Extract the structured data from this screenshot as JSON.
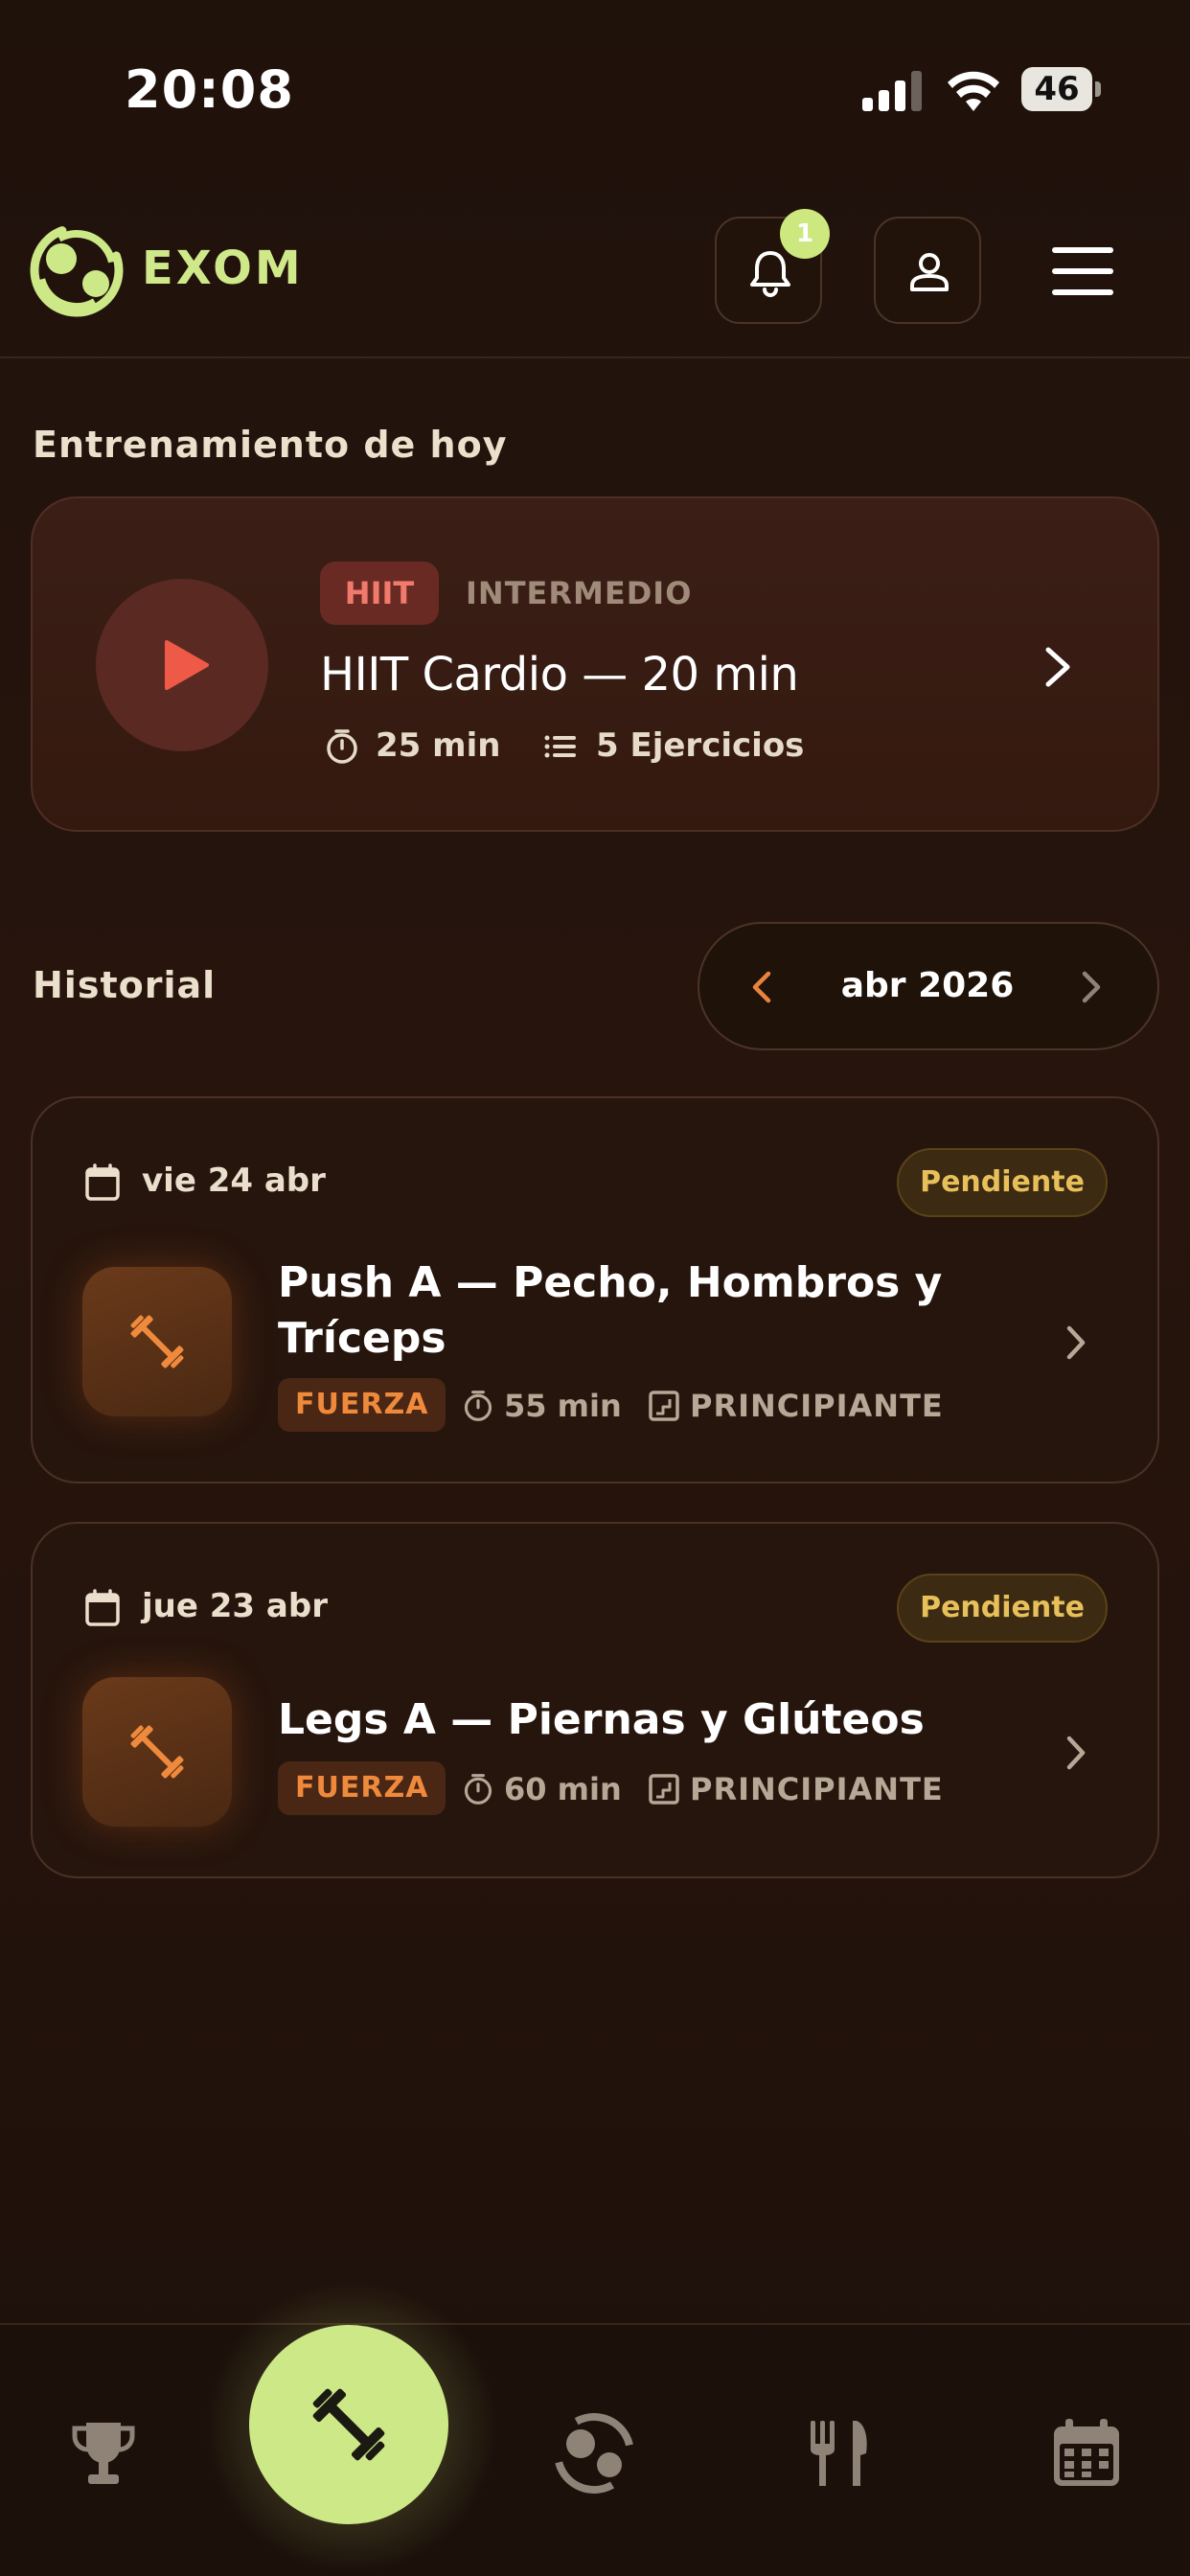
{
  "status_bar": {
    "time": "20:08",
    "battery": "46"
  },
  "header": {
    "brand": "EXOM",
    "notification_count": "1"
  },
  "today": {
    "section_title": "Entrenamiento de hoy",
    "tag": "HIIT",
    "level": "INTERMEDIO",
    "name": "HIIT Cardio — 20 min",
    "duration": "25 min",
    "exercises": "5 Ejercicios"
  },
  "history": {
    "section_title": "Historial",
    "month": "abr 2026",
    "items": [
      {
        "date": "vie 24 abr",
        "status": "Pendiente",
        "name": "Push A — Pecho, Hombros y Tríceps",
        "category": "FUERZA",
        "duration": "55 min",
        "level": "PRINCIPIANTE"
      },
      {
        "date": "jue 23 abr",
        "status": "Pendiente",
        "name": "Legs A — Piernas y Glúteos",
        "category": "FUERZA",
        "duration": "60 min",
        "level": "PRINCIPIANTE"
      }
    ]
  },
  "nav": {
    "items": [
      "trophy-icon",
      "dumbbell-icon",
      "exom-logo-icon",
      "utensils-icon",
      "calendar-icon"
    ],
    "active": "dumbbell-icon"
  },
  "colors": {
    "accent": "#cde887",
    "hiit": "#f07a6c",
    "strength": "#ef8a3c",
    "pending": "#e8c05a"
  }
}
